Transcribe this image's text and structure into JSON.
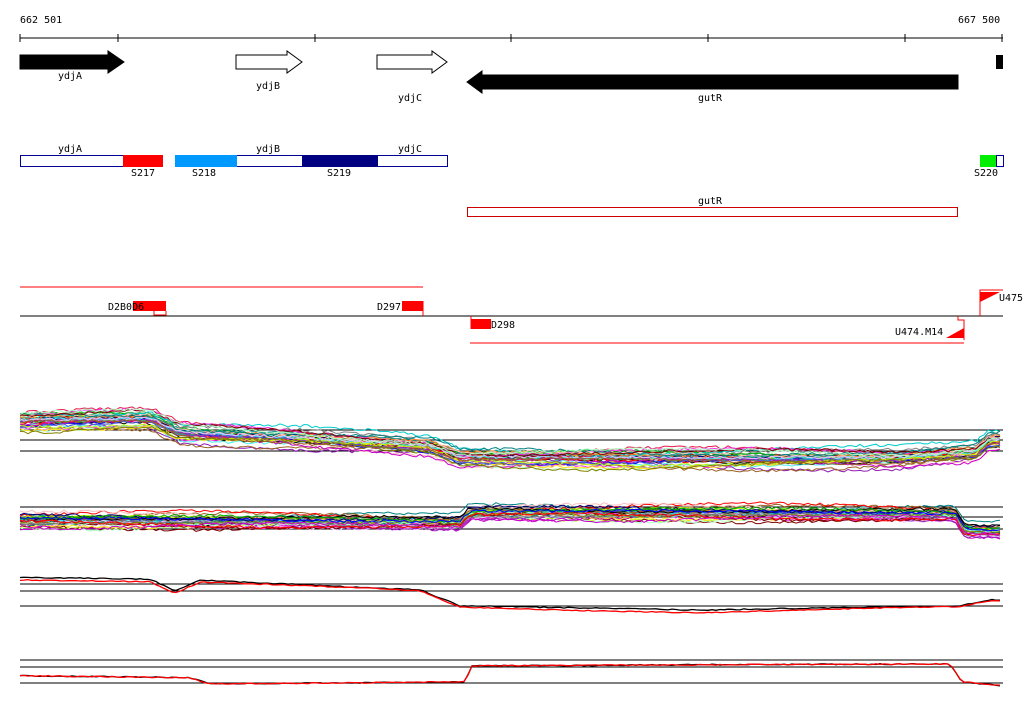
{
  "axis": {
    "start_label": "662 501",
    "end_label": "667 500"
  },
  "genes": [
    {
      "name": "ydjA",
      "strand": "+",
      "style": "filled"
    },
    {
      "name": "ydjB",
      "strand": "+",
      "style": "outline"
    },
    {
      "name": "ydjC",
      "strand": "+",
      "style": "outline"
    },
    {
      "name": "gutR",
      "strand": "-",
      "style": "filled"
    }
  ],
  "transcript_labels": {
    "ydjA": "ydjA",
    "ydjB": "ydjB",
    "ydjC": "ydjC",
    "gutR": "gutR"
  },
  "segments": [
    {
      "name": "S217",
      "color": "#ff0000"
    },
    {
      "name": "S218",
      "color": "#0099ff"
    },
    {
      "name": "S219",
      "color": "#000080"
    },
    {
      "name": "S220",
      "color": "#00ee00"
    }
  ],
  "features": {
    "forward": [
      {
        "name": "D2B0D6"
      },
      {
        "name": "D297"
      },
      {
        "name": "U475"
      }
    ],
    "reverse": [
      {
        "name": "D298"
      },
      {
        "name": "U474.M14"
      }
    ]
  },
  "colors": {
    "feature": "#ff0000",
    "gene": "#000000",
    "segment_outline": "#000099",
    "transcript_outline": "#cc0000",
    "baseline": "#000000"
  },
  "tracks": [
    {
      "name": "expression-forward-all-conditions",
      "series_count": 40
    },
    {
      "name": "expression-reverse-all-conditions",
      "series_count": 40
    },
    {
      "name": "expression-forward-summary",
      "series_names": [
        "black",
        "red"
      ]
    },
    {
      "name": "expression-reverse-summary",
      "series_names": [
        "black",
        "red"
      ]
    }
  ]
}
